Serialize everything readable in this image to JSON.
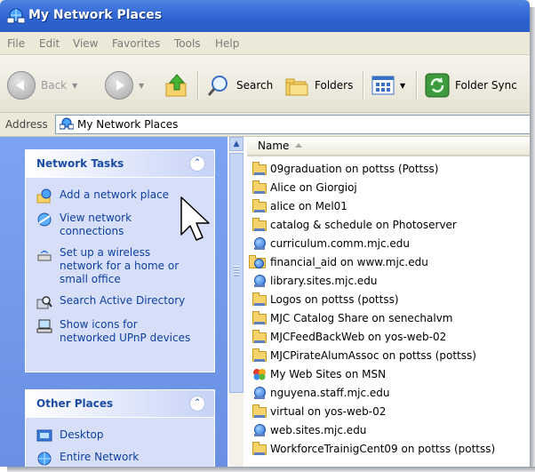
{
  "window": {
    "title": "My Network Places"
  },
  "menu": [
    "File",
    "Edit",
    "View",
    "Favorites",
    "Tools",
    "Help"
  ],
  "toolbar": {
    "back": "Back",
    "search": "Search",
    "folders": "Folders",
    "folder_sync": "Folder Sync"
  },
  "address": {
    "label": "Address",
    "value": "My Network Places"
  },
  "network_tasks": {
    "title": "Network Tasks",
    "items": [
      {
        "label": "Add a network place",
        "icon": "add-network-place-icon"
      },
      {
        "label": "View network connections",
        "icon": "network-connections-icon"
      },
      {
        "label": "Set up a wireless network for a home or small office",
        "icon": "wireless-icon"
      },
      {
        "label": "Search Active Directory",
        "icon": "search-directory-icon"
      },
      {
        "label": "Show icons for networked UPnP devices",
        "icon": "upnp-icon"
      }
    ]
  },
  "other_places": {
    "title": "Other Places",
    "items": [
      {
        "label": "Desktop",
        "icon": "desktop-icon"
      },
      {
        "label": "Entire Network",
        "icon": "entire-network-icon"
      }
    ]
  },
  "list": {
    "column": "Name",
    "items": [
      {
        "name": "09graduation on pottss (Pottss)",
        "icon": "network-folder"
      },
      {
        "name": "Alice on Giorgioj",
        "icon": "network-folder"
      },
      {
        "name": "alice on Mel01",
        "icon": "network-folder"
      },
      {
        "name": "catalog & schedule on Photoserver",
        "icon": "network-folder"
      },
      {
        "name": "curriculum.comm.mjc.edu",
        "icon": "web-computer"
      },
      {
        "name": "financial_aid on www.mjc.edu",
        "icon": "web-folder"
      },
      {
        "name": "library.sites.mjc.edu",
        "icon": "web-computer"
      },
      {
        "name": "Logos on pottss (pottss)",
        "icon": "network-folder"
      },
      {
        "name": "MJC Catalog Share on senechalvm",
        "icon": "network-folder"
      },
      {
        "name": "MJCFeedBackWeb on yos-web-02",
        "icon": "network-folder"
      },
      {
        "name": "MJCPirateAlumAssoc on pottss (pottss)",
        "icon": "network-folder"
      },
      {
        "name": "My Web Sites on MSN",
        "icon": "msn"
      },
      {
        "name": "nguyena.staff.mjc.edu",
        "icon": "web-computer"
      },
      {
        "name": "virtual on yos-web-02",
        "icon": "network-folder"
      },
      {
        "name": "web.sites.mjc.edu",
        "icon": "web-computer"
      },
      {
        "name": "WorkforceTrainigCent09 on pottss (pottss)",
        "icon": "network-folder"
      }
    ]
  }
}
